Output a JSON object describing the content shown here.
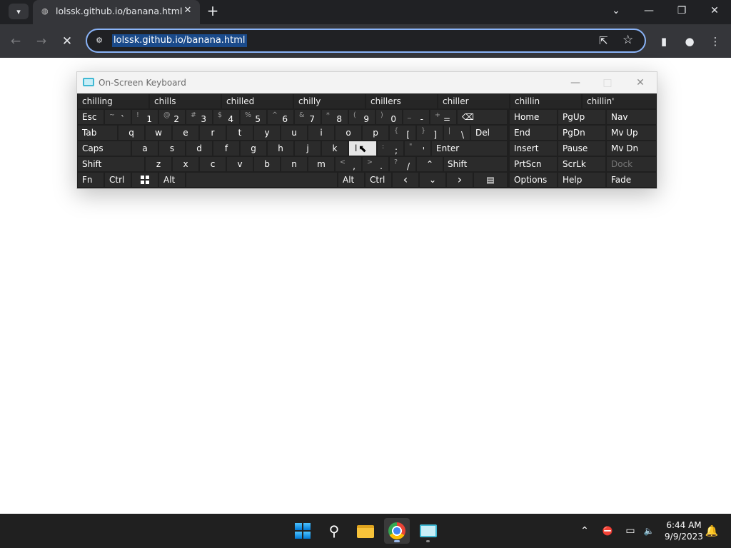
{
  "browser": {
    "tab": {
      "title": "lolssk.github.io/banana.html",
      "favicon": "globe-icon"
    },
    "address": {
      "url": "lolssk.github.io/banana.html"
    },
    "icons": {
      "tab_search": "▾",
      "close": "✕",
      "new_tab": "+",
      "minimize": "—",
      "restore": "❐",
      "window_close": "✕",
      "chevron": "⌄",
      "back": "←",
      "forward": "→",
      "stop": "✕",
      "tune": "⚙",
      "share": "⇱",
      "star": "☆",
      "side_panel": "▮",
      "profile": "●",
      "menu": "⋮"
    }
  },
  "osk": {
    "title": "On-Screen Keyboard",
    "controls": {
      "minimize": "—",
      "maximize": "□",
      "close": "✕"
    },
    "suggestions": [
      "chilling",
      "chills",
      "chilled",
      "chilly",
      "chillers",
      "chiller",
      "chillin",
      "chillin'"
    ],
    "row1": {
      "esc": "Esc",
      "keys": [
        {
          "shift": "~",
          "main": "`"
        },
        {
          "shift": "!",
          "main": "1"
        },
        {
          "shift": "@",
          "main": "2"
        },
        {
          "shift": "#",
          "main": "3"
        },
        {
          "shift": "$",
          "main": "4"
        },
        {
          "shift": "%",
          "main": "5"
        },
        {
          "shift": "^",
          "main": "6"
        },
        {
          "shift": "&",
          "main": "7"
        },
        {
          "shift": "*",
          "main": "8"
        },
        {
          "shift": "(",
          "main": "9"
        },
        {
          "shift": ")",
          "main": "0"
        },
        {
          "shift": "_",
          "main": "-"
        },
        {
          "shift": "+",
          "main": "="
        }
      ],
      "backspace": "⌫"
    },
    "row2": {
      "tab": "Tab",
      "letters": [
        "q",
        "w",
        "e",
        "r",
        "t",
        "y",
        "u",
        "i",
        "o",
        "p"
      ],
      "brackets": [
        {
          "shift": "{",
          "main": "["
        },
        {
          "shift": "}",
          "main": "]"
        },
        {
          "shift": "|",
          "main": "\\"
        }
      ],
      "del": "Del"
    },
    "row3": {
      "caps": "Caps",
      "letters": [
        "a",
        "s",
        "d",
        "f",
        "g",
        "h",
        "j",
        "k",
        "l"
      ],
      "punct": [
        {
          "shift": ":",
          "main": ";"
        },
        {
          "shift": "\"",
          "main": "'"
        }
      ],
      "enter": "Enter"
    },
    "row4": {
      "shift": "Shift",
      "letters": [
        "z",
        "x",
        "c",
        "v",
        "b",
        "n",
        "m"
      ],
      "punct": [
        {
          "shift": "<",
          "main": ","
        },
        {
          "shift": ">",
          "main": "."
        },
        {
          "shift": "?",
          "main": "/"
        }
      ],
      "up": "⌃",
      "shift_right": "Shift"
    },
    "row5": {
      "fn": "Fn",
      "ctrl": "Ctrl",
      "alt": "Alt",
      "alt_right": "Alt",
      "ctrl_right": "Ctrl",
      "left": "‹",
      "down": "⌄",
      "right": "›",
      "menu": "▤"
    },
    "nav": {
      "row1": [
        "Home",
        "PgUp",
        "Nav"
      ],
      "row2": [
        "End",
        "PgDn",
        "Mv Up"
      ],
      "row3": [
        "Insert",
        "Pause",
        "Mv Dn"
      ],
      "row4": [
        "PrtScn",
        "ScrLk",
        "Dock"
      ],
      "row5": [
        "Options",
        "Help",
        "Fade"
      ]
    },
    "highlighted_key": "l"
  },
  "taskbar": {
    "search": "⚲",
    "tray_icons": {
      "chevron": "⌃",
      "network": "⛔",
      "display": "▭",
      "volume": "🔈",
      "bell": "🔔"
    },
    "time": "6:44 AM",
    "date": "9/9/2023"
  }
}
